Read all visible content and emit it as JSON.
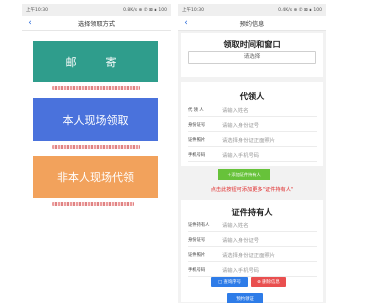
{
  "left_screen": {
    "status": {
      "left": "上午10:30",
      "right": "0.8K/s ⊕ ✆ ⊠ ∎ 100"
    },
    "nav": {
      "back_icon": "chevron-left",
      "title": "选择领取方式"
    },
    "options": [
      {
        "label": "邮　寄",
        "color": "#2f9d8c"
      },
      {
        "label": "本人现场领取",
        "color": "#4a72dc"
      },
      {
        "label": "非本人现场代领",
        "color": "#f2a25c"
      }
    ]
  },
  "right_screen": {
    "status": {
      "left": "上午10:30",
      "right": "0.4K/s ⊕ ✆ ⊠ ∎ 100"
    },
    "nav": {
      "back_icon": "chevron-left",
      "title": "预约信息"
    },
    "time_section": {
      "title": "领取时间和窗口",
      "select_placeholder": "请选择"
    },
    "agent_section": {
      "title": "代领人",
      "fields": [
        {
          "label": "代 领 人",
          "placeholder": "请输入姓名"
        },
        {
          "label": "身份证号",
          "placeholder": "请输入身份证号"
        },
        {
          "label": "证件照片",
          "placeholder": "请选择身份证正面照片"
        },
        {
          "label": "手机号码",
          "placeholder": "请输入手机号码"
        }
      ],
      "add_button": "＋添加证件持有人"
    },
    "hint": "点击此按钮可添加更多\"证件持有人\"",
    "holder_section": {
      "title": "证件持有人",
      "fields": [
        {
          "label": "证件持有人",
          "placeholder": "请输入姓名"
        },
        {
          "label": "身份证号",
          "placeholder": "请输入身份证号"
        },
        {
          "label": "证件照片",
          "placeholder": "请选择身份证正面照片"
        },
        {
          "label": "手机号码",
          "placeholder": "请输入手机号码"
        }
      ],
      "save_button": "□ 查询序号",
      "delete_button": "⊗ 删除信息"
    },
    "submit_button": "预约领证"
  },
  "colors": {
    "primary": "#2e7ce8",
    "success": "#67c23a",
    "danger": "#e94f4f",
    "hint": "#e02a2a"
  }
}
